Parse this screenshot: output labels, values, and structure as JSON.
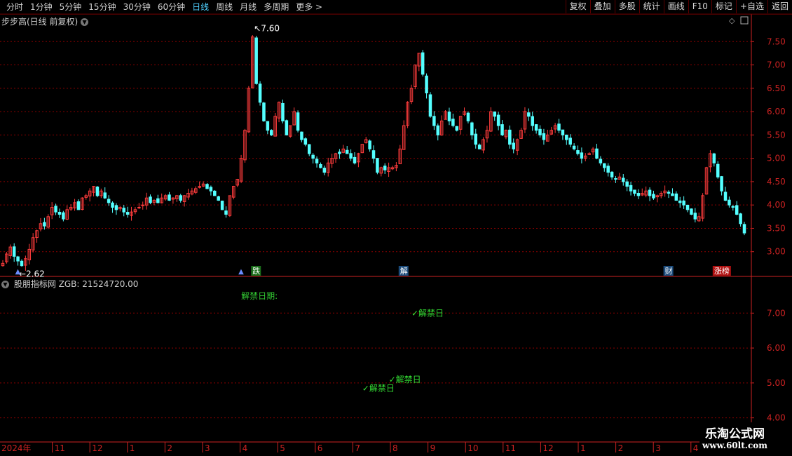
{
  "toolbar": {
    "periods": [
      {
        "label": "分时",
        "active": false
      },
      {
        "label": "1分钟",
        "active": false
      },
      {
        "label": "5分钟",
        "active": false
      },
      {
        "label": "15分钟",
        "active": false
      },
      {
        "label": "30分钟",
        "active": false
      },
      {
        "label": "60分钟",
        "active": false
      },
      {
        "label": "日线",
        "active": true
      },
      {
        "label": "周线",
        "active": false
      },
      {
        "label": "月线",
        "active": false
      },
      {
        "label": "多周期",
        "active": false
      },
      {
        "label": "更多",
        "active": false
      }
    ],
    "more_arrow": ">",
    "buttons": [
      "复权",
      "叠加",
      "多股",
      "统计",
      "画线",
      "F10",
      "标记",
      "+自选",
      "返回"
    ]
  },
  "main_panel": {
    "title": "步步高(日线 前复权)",
    "high_label": "7.60",
    "low_label": "2.62",
    "markers": [
      {
        "text": "跌",
        "color": "#ffffff",
        "bg": "#1a6e1a"
      },
      {
        "text": "解",
        "color": "#ffffff",
        "bg": "#1a4a7a"
      },
      {
        "text": "财",
        "color": "#ffffff",
        "bg": "#1a4a7a"
      },
      {
        "text": "涨榜",
        "color": "#ffffff",
        "bg": "#b01010"
      }
    ]
  },
  "indicator_panel": {
    "title": "股朋指标网 ZGB: 21524720.00",
    "label_date": "解禁日期:",
    "events": [
      {
        "text": "✓解禁日",
        "value": 7.0
      },
      {
        "text": "✓解禁日",
        "value": 5.1
      },
      {
        "text": "✓解禁日",
        "value": 4.85
      }
    ]
  },
  "time_axis": [
    "2024年",
    "11",
    "12",
    "1",
    "2",
    "3",
    "4",
    "5",
    "6",
    "7",
    "8",
    "9",
    "10",
    "11",
    "12",
    "1",
    "2",
    "3",
    "4",
    "5"
  ],
  "watermark": {
    "line1": "乐淘公式网",
    "line2": "www.60lt.com"
  },
  "colors": {
    "up": "#ff3c3c",
    "down": "#54ffff",
    "grid": "#8b0000",
    "axis": "#cc2222",
    "event": "#33dd33",
    "date_label": "#33cc33"
  },
  "chart_data": [
    {
      "type": "candlestick",
      "title": "步步高(日线 前复权)",
      "y_ticks": [
        3.0,
        3.5,
        4.0,
        4.5,
        5.0,
        5.5,
        6.0,
        6.5,
        7.0,
        7.5
      ],
      "ylim": [
        2.5,
        7.85
      ],
      "grid": true,
      "close_series": [
        2.75,
        2.95,
        3.1,
        2.9,
        2.8,
        2.7,
        2.85,
        3.05,
        3.3,
        3.45,
        3.6,
        3.55,
        3.75,
        3.95,
        3.85,
        3.8,
        3.7,
        3.9,
        3.95,
        4.05,
        3.9,
        4.15,
        4.2,
        4.3,
        4.4,
        4.2,
        4.3,
        4.15,
        4.05,
        3.95,
        3.9,
        3.95,
        3.85,
        3.8,
        3.85,
        3.9,
        3.95,
        4.0,
        4.15,
        4.05,
        4.1,
        4.05,
        4.15,
        4.2,
        4.1,
        4.15,
        4.2,
        4.1,
        4.2,
        4.25,
        4.3,
        4.35,
        4.4,
        4.45,
        4.35,
        4.3,
        4.2,
        4.1,
        3.9,
        3.8,
        4.2,
        4.4,
        4.55,
        5.0,
        5.6,
        6.5,
        7.6,
        6.6,
        6.2,
        5.8,
        5.6,
        5.5,
        5.9,
        6.2,
        5.8,
        5.5,
        5.7,
        6.0,
        5.6,
        5.4,
        5.3,
        5.1,
        5.0,
        4.9,
        4.8,
        4.7,
        4.9,
        5.0,
        5.1,
        5.1,
        5.2,
        5.1,
        5.0,
        4.9,
        5.1,
        5.3,
        5.4,
        5.2,
        5.0,
        4.7,
        4.8,
        4.75,
        4.8,
        4.8,
        4.85,
        5.2,
        5.7,
        6.2,
        6.5,
        7.0,
        7.25,
        6.8,
        6.4,
        5.9,
        5.7,
        5.5,
        5.8,
        6.0,
        5.8,
        5.7,
        5.6,
        5.9,
        6.0,
        5.8,
        5.5,
        5.3,
        5.2,
        5.4,
        5.6,
        6.0,
        5.9,
        5.7,
        5.5,
        5.6,
        5.3,
        5.2,
        5.4,
        5.6,
        6.0,
        5.9,
        5.7,
        5.6,
        5.5,
        5.4,
        5.5,
        5.6,
        5.7,
        5.6,
        5.5,
        5.4,
        5.3,
        5.2,
        5.1,
        5.0,
        5.05,
        5.1,
        5.2,
        5.0,
        4.9,
        4.8,
        4.7,
        4.6,
        4.55,
        4.6,
        4.5,
        4.4,
        4.3,
        4.25,
        4.2,
        4.25,
        4.3,
        4.2,
        4.15,
        4.2,
        4.25,
        4.3,
        4.25,
        4.2,
        4.1,
        4.05,
        4.0,
        3.9,
        3.8,
        3.7,
        3.75,
        4.2,
        4.8,
        5.1,
        4.9,
        4.6,
        4.3,
        4.1,
        4.0,
        3.95,
        3.8,
        3.6,
        3.4
      ]
    },
    {
      "type": "indicator",
      "title": "股朋指标网 ZGB: 21524720.00",
      "y_ticks": [
        4.0,
        5.0,
        6.0,
        7.0
      ],
      "ylim": [
        3.35,
        7.85
      ],
      "grid": true
    }
  ]
}
